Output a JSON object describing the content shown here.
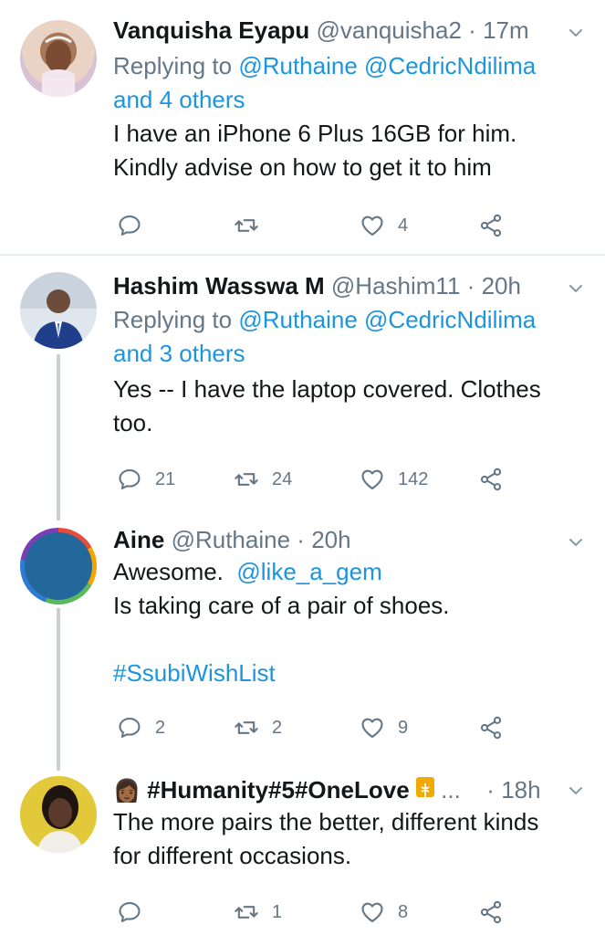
{
  "tweets": [
    {
      "name": "Vanquisha Eyapu",
      "handle": "@vanquisha2",
      "time": "17m",
      "reply_prefix": "Replying to ",
      "reply_to_1": "@Ruthaine",
      "reply_to_2": "@CedricNdilima",
      "reply_others": "and 4 others",
      "text_1": "I have an iPhone 6 Plus 16GB for him.",
      "text_2": "Kindly advise on how to get it to him",
      "replies": "",
      "retweets": "",
      "likes": "4"
    },
    {
      "name": "Hashim Wasswa M",
      "handle": "@Hashim11",
      "time": "20h",
      "reply_prefix": "Replying to ",
      "reply_to_1": "@Ruthaine",
      "reply_to_2": "@CedricNdilima",
      "reply_others": "and 3 others",
      "text_1": "Yes -- I have the laptop covered. Clothes",
      "text_2": "too.",
      "replies": "21",
      "retweets": "24",
      "likes": "142"
    },
    {
      "name": "Aine",
      "handle": "@Ruthaine",
      "time": "20h",
      "text_1a": "Awesome.",
      "mention": "@like_a_gem",
      "text_2": "Is taking care of a pair of shoes.",
      "hashtag": "#SsubiWishList",
      "replies": "2",
      "retweets": "2",
      "likes": "9"
    },
    {
      "name": "#Humanity#5#OneLove",
      "name_ellipsis": "...",
      "time": "18h",
      "text_1": "The more pairs the better, different kinds",
      "text_2": "for different occasions.",
      "replies": "",
      "retweets": "1",
      "likes": "8"
    }
  ],
  "separator": "·",
  "icons": [
    "reply-icon",
    "retweet-icon",
    "like-icon",
    "share-icon",
    "chevron-down-icon"
  ],
  "colors": {
    "link": "#1b95e0",
    "muted": "#657786",
    "text": "#14171a",
    "divider": "#e6ecf0"
  }
}
